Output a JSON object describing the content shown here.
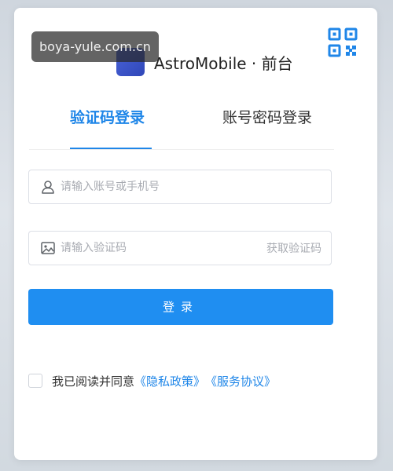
{
  "watermark": "boya-yule.com.cn",
  "brand": {
    "logo_text": "Astro",
    "name": "AstroMobile · 前台"
  },
  "tabs": [
    {
      "label": "验证码登录",
      "active": true
    },
    {
      "label": "账号密码登录",
      "active": false
    }
  ],
  "account_field": {
    "placeholder": "请输入账号或手机号",
    "value": "",
    "icon": "user-icon"
  },
  "code_field": {
    "placeholder": "请输入验证码",
    "value": "",
    "icon": "image-icon",
    "get_code_label": "获取验证码"
  },
  "login_button": "登录",
  "agreement": {
    "prefix": "我已阅读并同意",
    "privacy_link": "《隐私政策》",
    "service_link": "《服务协议》",
    "checked": false
  },
  "colors": {
    "accent": "#1f86e8",
    "button": "#1f8ef1",
    "logo": "#3a55c8"
  },
  "qr_icon": "qr-code-icon"
}
